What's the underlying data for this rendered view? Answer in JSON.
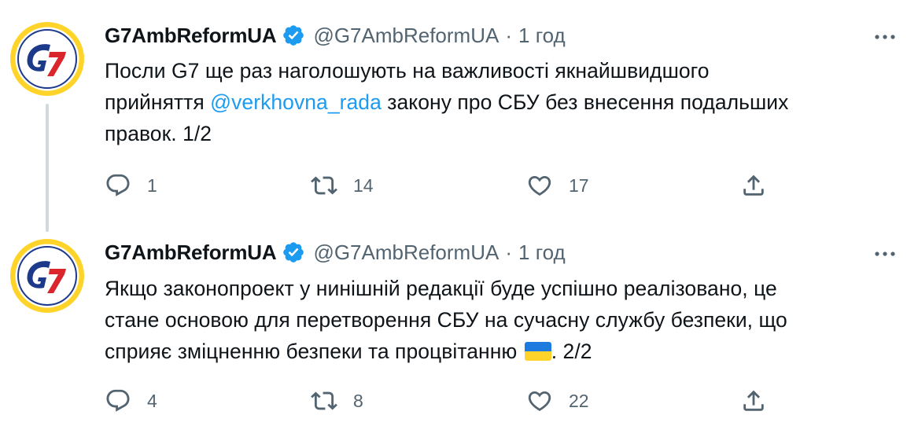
{
  "colors": {
    "accent": "#1d9bf0",
    "text": "#0f1419",
    "muted": "#536471",
    "thread_line": "#cfd9de",
    "avatar_blue": "#1d3a8a",
    "avatar_red": "#d9252b",
    "avatar_yellow": "#ffd42a"
  },
  "tweets": [
    {
      "display_name": "G7AmbReformUA",
      "handle": "@G7AmbReformUA",
      "separator": "·",
      "time": "1 год",
      "avatar_text": "G7",
      "body": {
        "line1": "Посли G7 ще раз наголошують на важливості якнайшвидшого",
        "line2_before": "прийняття ",
        "mention": "@verkhovna_rada",
        "line2_after": " закону про СБУ без внесення подальших",
        "line3": "правок. 1/2"
      },
      "stats": {
        "replies": "1",
        "retweets": "14",
        "likes": "17"
      }
    },
    {
      "display_name": "G7AmbReformUA",
      "handle": "@G7AmbReformUA",
      "separator": "·",
      "time": "1 год",
      "avatar_text": "G7",
      "body": {
        "line1": "Якщо законопроект у нинішній редакції буде успішно реалізовано, це",
        "line2": "стане основою для перетворення СБУ на сучасну службу безпеки, що",
        "line3_before": "сприяє зміцненню безпеки та процвітанню ",
        "line3_after": ". 2/2"
      },
      "stats": {
        "replies": "4",
        "retweets": "8",
        "likes": "22"
      }
    }
  ],
  "icons": {
    "verified": "verified-badge-icon",
    "more": "more-horizontal-icon",
    "reply": "reply-bubble-icon",
    "retweet": "retweet-icon",
    "like": "heart-icon",
    "share": "share-upload-icon",
    "flag": "ukraine-flag-emoji"
  }
}
